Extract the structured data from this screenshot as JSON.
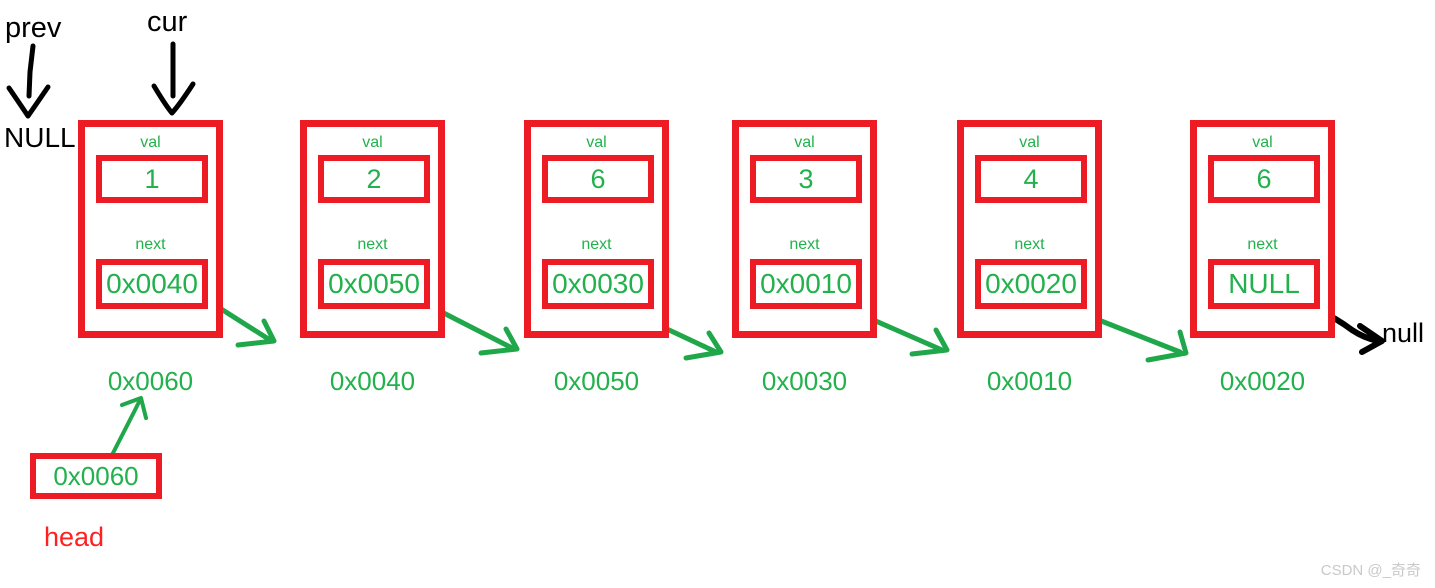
{
  "diagram": {
    "title": "Singly linked list node chain with prev/cur pointers",
    "colors": {
      "node_border": "#ED1C24",
      "text_green": "#22B14C",
      "head_label": "#FF2020",
      "arrow_green": "#1FA74A",
      "arrow_black": "#000000",
      "background": "#FFFFFF"
    }
  },
  "pointers": {
    "prev": "prev",
    "cur": "cur",
    "prev_target": "NULL",
    "tail_null": "null"
  },
  "labels": {
    "val": "val",
    "next": "next"
  },
  "nodes": [
    {
      "address": "0x0060",
      "val": "1",
      "next": "0x0040"
    },
    {
      "address": "0x0040",
      "val": "2",
      "next": "0x0050"
    },
    {
      "address": "0x0050",
      "val": "6",
      "next": "0x0030"
    },
    {
      "address": "0x0030",
      "val": "3",
      "next": "0x0010"
    },
    {
      "address": "0x0010",
      "val": "4",
      "next": "0x0020"
    },
    {
      "address": "0x0020",
      "val": "6",
      "next": "NULL"
    }
  ],
  "head": {
    "value": "0x0060",
    "label": "head"
  },
  "watermark": "CSDN @_奇奇"
}
